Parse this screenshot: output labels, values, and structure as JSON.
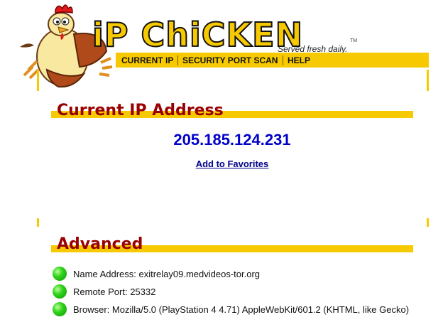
{
  "header": {
    "logo_text": "iP ChiCKEN",
    "tagline": "Served fresh daily.",
    "trademark": "TM"
  },
  "nav": {
    "items": [
      {
        "label": "CURRENT IP"
      },
      {
        "label": "SECURITY PORT SCAN"
      },
      {
        "label": "HELP"
      }
    ]
  },
  "current_ip": {
    "heading": "Current IP Address",
    "ip": "205.185.124.231",
    "favorites_link": "Add to Favorites"
  },
  "advanced": {
    "heading": "Advanced",
    "rows": [
      {
        "label": "Name Address: exitrelay09.medvideos-tor.org"
      },
      {
        "label": "Remote Port: 25332"
      },
      {
        "label": "Browser: Mozilla/5.0 (PlayStation 4 4.71) AppleWebKit/601.2 (KHTML, like Gecko)"
      }
    ]
  },
  "colors": {
    "brand_yellow": "#f7c900",
    "heading_red": "#990000",
    "ip_blue": "#0000cc",
    "status_green": "#2fd21a"
  },
  "icons": {
    "mascot": "chicken-mascot-icon",
    "status": "green-dot-icon"
  }
}
